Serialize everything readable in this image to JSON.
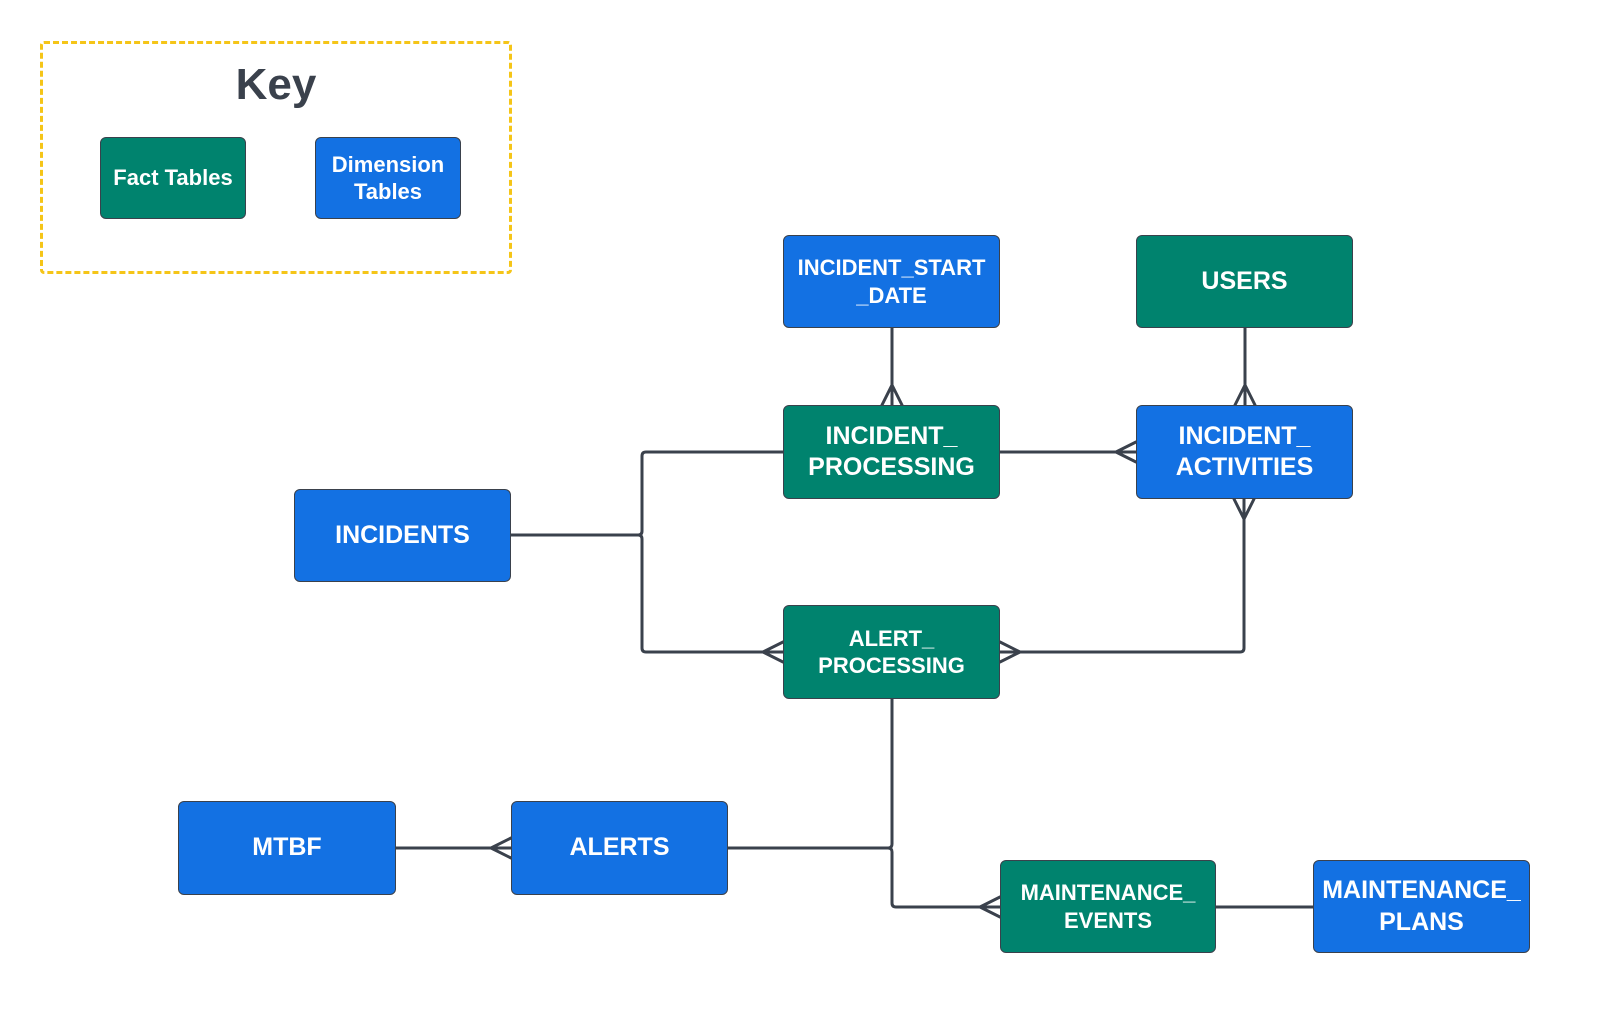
{
  "key": {
    "title": "Key",
    "items": [
      {
        "label": "Fact Tables",
        "type": "fact"
      },
      {
        "label": "Dimension\nTables",
        "type": "dimension"
      }
    ]
  },
  "colors": {
    "fact": "#00836e",
    "dimension": "#1371e3",
    "line": "#3a414c",
    "key_border": "#f5c518"
  },
  "nodes": {
    "incident_start_date": {
      "label": "INCIDENT_START\n_DATE",
      "type": "dimension"
    },
    "users": {
      "label": "USERS",
      "type": "fact"
    },
    "incident_processing": {
      "label": "INCIDENT_\nPROCESSING",
      "type": "fact"
    },
    "incident_activities": {
      "label": "INCIDENT_\nACTIVITIES",
      "type": "dimension"
    },
    "incidents": {
      "label": "INCIDENTS",
      "type": "dimension"
    },
    "alert_processing": {
      "label": "ALERT_\nPROCESSING",
      "type": "fact"
    },
    "mtbf": {
      "label": "MTBF",
      "type": "dimension"
    },
    "alerts": {
      "label": "ALERTS",
      "type": "dimension"
    },
    "maintenance_events": {
      "label": "MAINTENANCE_\nEVENTS",
      "type": "fact"
    },
    "maintenance_plans": {
      "label": "MAINTENANCE_\nPLANS",
      "type": "dimension"
    }
  },
  "relationships": [
    {
      "from": "incident_start_date",
      "to": "incident_processing",
      "cardinality": "one-to-many"
    },
    {
      "from": "users",
      "to": "incident_activities",
      "cardinality": "one-to-many"
    },
    {
      "from": "incident_processing",
      "to": "incident_activities",
      "cardinality": "one-to-many"
    },
    {
      "from": "incidents",
      "to": "incident_processing",
      "cardinality": "one-to-one"
    },
    {
      "from": "incidents",
      "to": "alert_processing",
      "cardinality": "one-to-many"
    },
    {
      "from": "incident_activities",
      "to": "alert_processing",
      "cardinality": "one-to-many"
    },
    {
      "from": "alert_processing",
      "to": "incident_activities",
      "cardinality": "many"
    },
    {
      "from": "mtbf",
      "to": "alerts",
      "cardinality": "one-to-many"
    },
    {
      "from": "alert_processing",
      "to": "alerts",
      "cardinality": "one-to-one"
    },
    {
      "from": "alert_processing",
      "to": "maintenance_events",
      "cardinality": "one-to-many"
    },
    {
      "from": "maintenance_events",
      "to": "maintenance_plans",
      "cardinality": "one-to-one"
    }
  ]
}
